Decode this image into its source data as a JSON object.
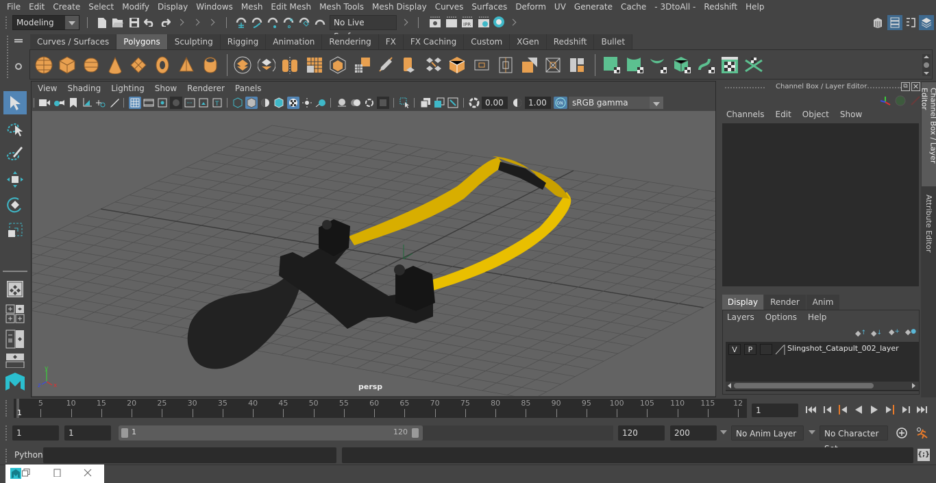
{
  "menubar": [
    "File",
    "Edit",
    "Create",
    "Select",
    "Modify",
    "Display",
    "Windows",
    "Mesh",
    "Edit Mesh",
    "Mesh Tools",
    "Mesh Display",
    "Curves",
    "Surfaces",
    "Deform",
    "UV",
    "Generate",
    "Cache",
    "- 3DtoAll -",
    "Redshift",
    "Help"
  ],
  "statusline": {
    "menu_set": "Modeling",
    "live_surface": "No Live Surface"
  },
  "shelf": {
    "tabs": [
      "Curves / Surfaces",
      "Polygons",
      "Sculpting",
      "Rigging",
      "Animation",
      "Rendering",
      "FX",
      "FX Caching",
      "Custom",
      "XGen",
      "Redshift",
      "Bullet"
    ],
    "active_tab": "Polygons"
  },
  "viewport": {
    "menu": [
      "View",
      "Shading",
      "Lighting",
      "Show",
      "Renderer",
      "Panels"
    ],
    "exposure": "0.00",
    "gamma": "1.00",
    "color_mgmt_badge": "ON",
    "color_space": "sRGB gamma",
    "camera_label": "persp",
    "axis": {
      "x": "x",
      "y": "y",
      "z": "z"
    },
    "colors": {
      "background": "#636363",
      "band": "#f2c400",
      "body": "#1e1e1e"
    }
  },
  "channel_box": {
    "title": "Channel Box / Layer Editor",
    "menu": [
      "Channels",
      "Edit",
      "Object",
      "Show"
    ]
  },
  "layer_editor": {
    "tabs": [
      "Display",
      "Render",
      "Anim"
    ],
    "active_tab": "Display",
    "menu": [
      "Layers",
      "Options",
      "Help"
    ],
    "layers": [
      {
        "v": "V",
        "p": "P",
        "name": "Slingshot_Catapult_002_layer"
      }
    ]
  },
  "side_tabs": [
    "Channel Box / Layer Editor",
    "Attribute Editor"
  ],
  "timeslider": {
    "ticks": [
      "5",
      "10",
      "15",
      "20",
      "25",
      "30",
      "35",
      "40",
      "45",
      "50",
      "55",
      "60",
      "65",
      "70",
      "75",
      "80",
      "85",
      "90",
      "95",
      "100",
      "105",
      "110",
      "115",
      "12"
    ],
    "current_marker": "1",
    "current_frame": "1"
  },
  "range": {
    "start": "1",
    "playback_start": "1",
    "slider_start": "1",
    "slider_end": "120",
    "playback_end": "120",
    "end": "200",
    "anim_layer": "No Anim Layer",
    "character_set": "No Character Set"
  },
  "cmdline": {
    "label": "Python"
  },
  "taskwin": {
    "icons": [
      "maya-app-icon",
      "restore-icon",
      "maximize-icon",
      "close-icon"
    ]
  }
}
